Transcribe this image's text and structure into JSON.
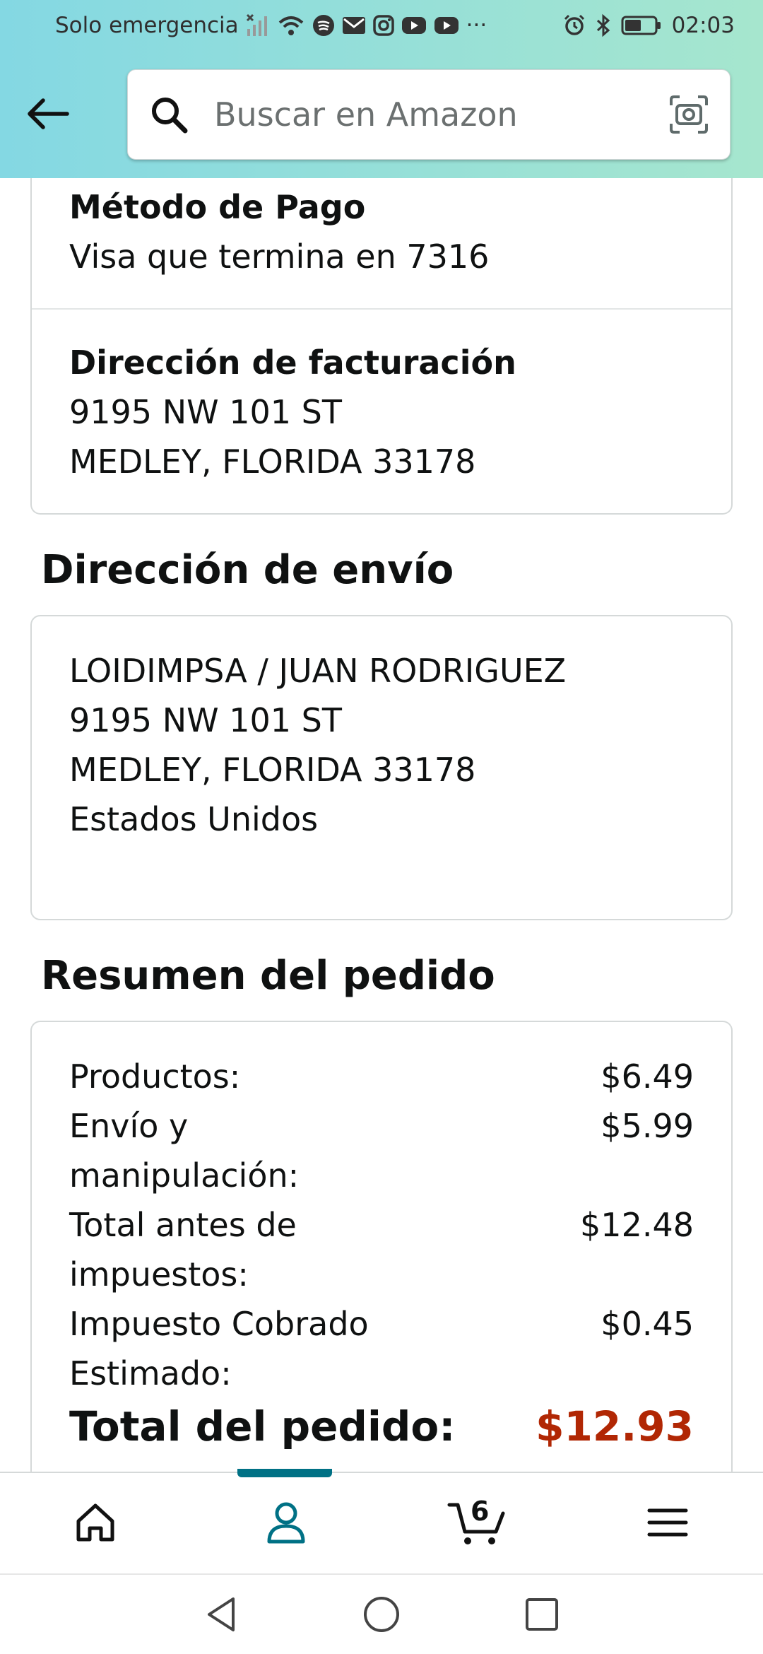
{
  "status_bar": {
    "carrier": "Solo emergencia",
    "time": "02:03",
    "overflow": "···",
    "icons": [
      "no-signal-icon",
      "wifi-icon",
      "spotify-icon",
      "mail-icon",
      "instagram-icon",
      "youtube-icon",
      "youtube-icon",
      "alarm-icon",
      "bluetooth-icon",
      "battery-icon"
    ]
  },
  "search": {
    "placeholder": "Buscar en Amazon"
  },
  "payment": {
    "method_label": "Método de Pago",
    "method_value": "Visa que termina en 7316",
    "billing_label": "Dirección de facturación",
    "billing_lines": [
      "9195 NW 101 ST",
      "MEDLEY, FLORIDA 33178"
    ]
  },
  "shipping": {
    "title": "Dirección de envío",
    "lines": [
      "LOIDIMPSA / JUAN RODRIGUEZ",
      "9195 NW 101 ST",
      "MEDLEY, FLORIDA 33178",
      "Estados Unidos"
    ]
  },
  "summary": {
    "title": "Resumen del pedido",
    "rows": [
      {
        "label": "Productos:",
        "value": "$6.49"
      },
      {
        "label": "Envío y manipulación:",
        "value": "$5.99"
      },
      {
        "label": "Total antes de impuestos:",
        "value": "$12.48"
      },
      {
        "label": "Impuesto Cobrado Estimado:",
        "value": "$0.45"
      }
    ],
    "total_label": "Total del pedido:",
    "total_value": "$12.93"
  },
  "bottom_nav": {
    "items": [
      "home-icon",
      "account-icon",
      "cart-icon",
      "menu-icon"
    ],
    "active": "account-icon",
    "cart_count": "6"
  },
  "colors": {
    "header_start": "#84d8e3",
    "header_end": "#a6e6ce",
    "active_accent": "#007185",
    "total_price": "#b12704"
  }
}
